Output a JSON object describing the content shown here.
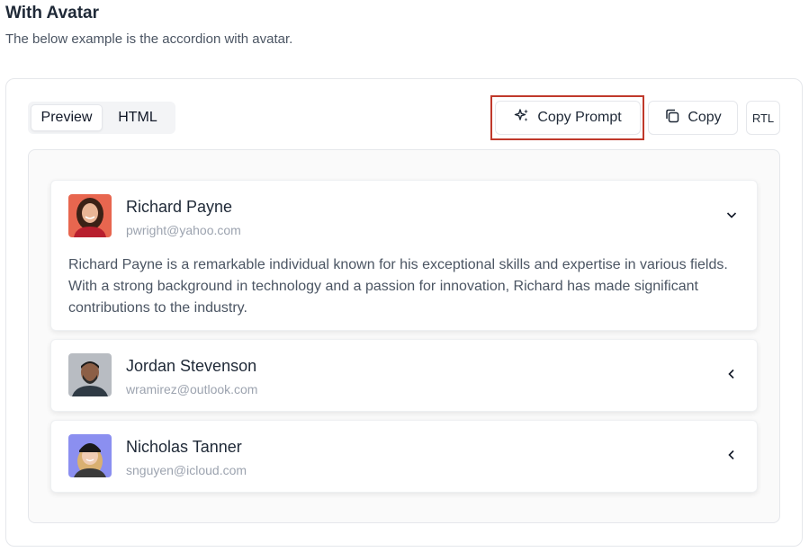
{
  "section": {
    "title": "With Avatar",
    "description": "The below example is the accordion with avatar."
  },
  "tabs": [
    {
      "label": "Preview",
      "active": true
    },
    {
      "label": "HTML",
      "active": false
    }
  ],
  "toolbar": {
    "copy_prompt_label": "Copy Prompt",
    "copy_label": "Copy",
    "rtl_label": "RTL"
  },
  "accordion": {
    "items": [
      {
        "name": "Richard Payne",
        "email": "pwright@yahoo.com",
        "expanded": true,
        "body": "Richard Payne is a remarkable individual known for his exceptional skills and expertise in various fields. With a strong background in technology and a passion for innovation, Richard has made significant contributions to the industry.",
        "avatar_bg": "#e8664f"
      },
      {
        "name": "Jordan Stevenson",
        "email": "wramirez@outlook.com",
        "expanded": false,
        "avatar_bg": "#b8bcc2"
      },
      {
        "name": "Nicholas Tanner",
        "email": "snguyen@icloud.com",
        "expanded": false,
        "avatar_bg": "#8b8ff0"
      }
    ]
  },
  "colors": {
    "highlight": "#c0392b",
    "border": "#e5e7eb",
    "text": "#1f2937",
    "muted": "#9ca3af"
  }
}
